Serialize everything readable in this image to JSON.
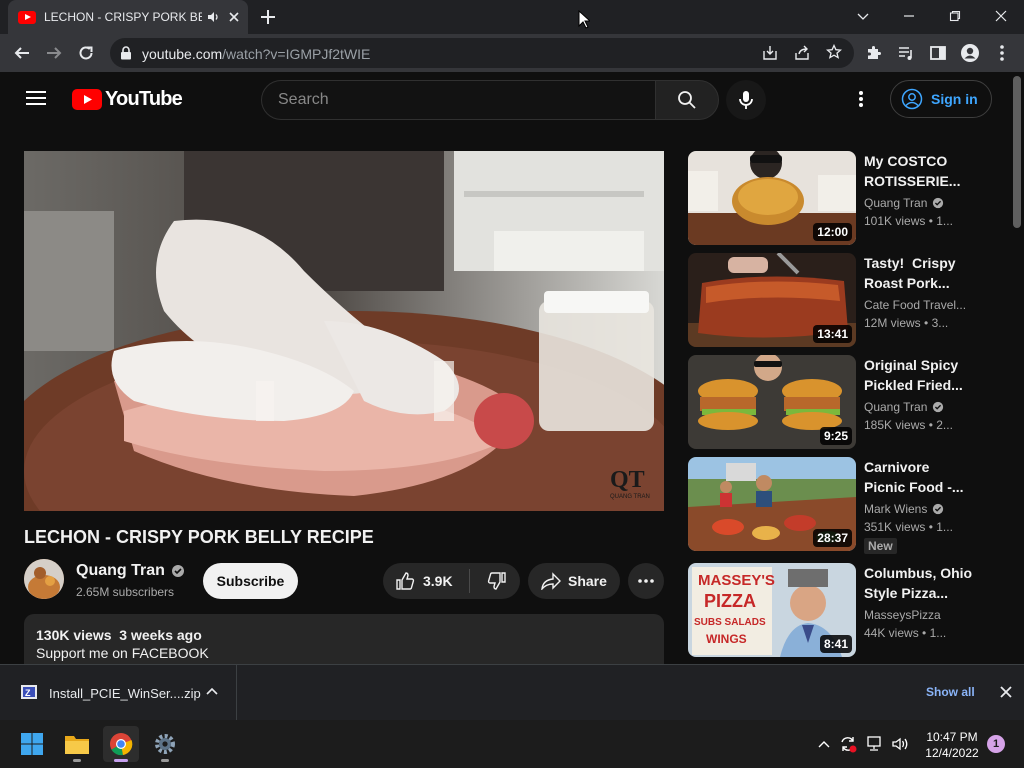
{
  "browser": {
    "tab_title": "LECHON - CRISPY PORK BELLY RECIPE",
    "url_host": "youtube.com",
    "url_path": "/watch?v=IGMPJf2tWIE"
  },
  "youtube": {
    "logo_text": "YouTube",
    "search_placeholder": "Search",
    "signin_label": "Sign in"
  },
  "video": {
    "watermark": "QT",
    "watermark_sub": "QUANG TRAN",
    "title": "LECHON - CRISPY PORK BELLY RECIPE",
    "channel": "Quang Tran",
    "subscribers": "2.65M subscribers",
    "subscribe_label": "Subscribe",
    "likes": "3.9K",
    "share_label": "Share",
    "views_date": "130K views  3 weeks ago",
    "description_line": "Support me on FACEBOOK"
  },
  "recommendations": [
    {
      "title": "My COSTCO ROTISSERIE...",
      "channel": "Quang Tran",
      "verified": true,
      "views": "101K views",
      "age": "1...",
      "duration": "12:00",
      "badge": ""
    },
    {
      "title": "Tasty!  Crispy Roast Pork...",
      "channel": "Cate Food Travel...",
      "verified": false,
      "views": "12M views",
      "age": "3...",
      "duration": "13:41",
      "badge": ""
    },
    {
      "title": "Original Spicy Pickled Fried...",
      "channel": "Quang Tran",
      "verified": true,
      "views": "185K views",
      "age": "2...",
      "duration": "9:25",
      "badge": ""
    },
    {
      "title": "Carnivore Picnic Food -...",
      "channel": "Mark Wiens",
      "verified": true,
      "views": "351K views",
      "age": "1...",
      "duration": "28:37",
      "badge": "New"
    },
    {
      "title": "Columbus, Ohio Style Pizza...",
      "channel": "MasseysPizza",
      "verified": false,
      "views": "44K views",
      "age": "1...",
      "duration": "8:41",
      "badge": ""
    }
  ],
  "thumb_text": {
    "pizza_line1": "MASSEY'S",
    "pizza_line2": "PIZZA",
    "pizza_line3": "SUBS SALADS",
    "pizza_line4": "WINGS"
  },
  "download": {
    "filename": "Install_PCIE_WinSer....zip",
    "show_all": "Show all"
  },
  "taskbar": {
    "time": "10:47 PM",
    "date": "12/4/2022",
    "notifications": "1"
  }
}
